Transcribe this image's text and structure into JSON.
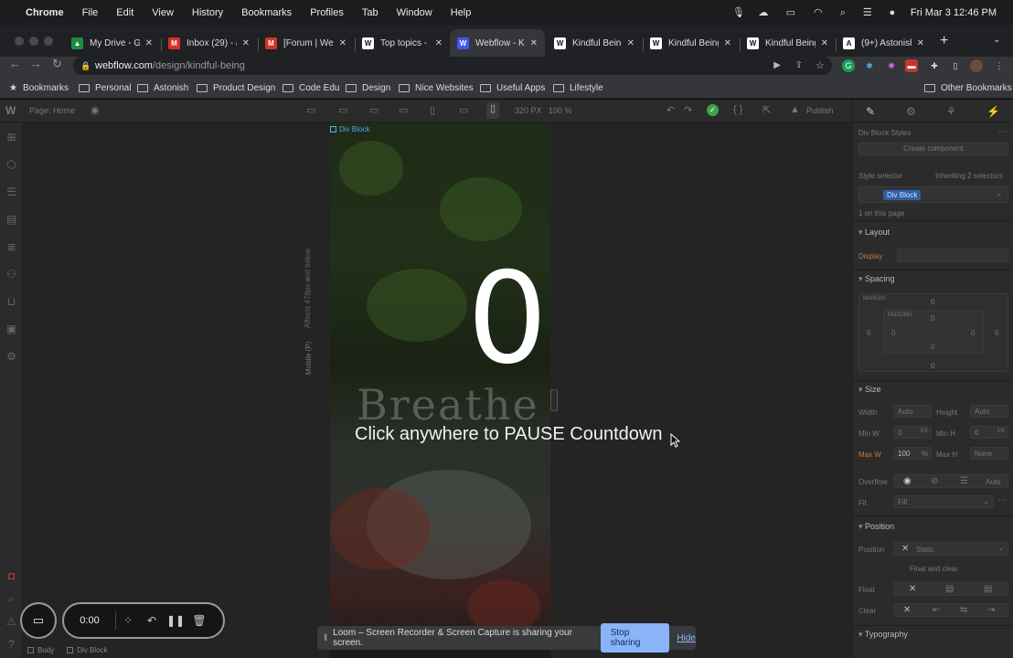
{
  "menubar": {
    "app": "Chrome",
    "items": [
      "File",
      "Edit",
      "View",
      "History",
      "Bookmarks",
      "Profiles",
      "Tab",
      "Window",
      "Help"
    ],
    "clock": "Fri Mar 3  12:46 PM"
  },
  "tabs": [
    {
      "title": "My Drive - Go",
      "favicon": "drive-icon",
      "color": "#f4b400"
    },
    {
      "title": "Inbox (29) - a",
      "favicon": "gmail-icon",
      "color": "#d93025"
    },
    {
      "title": "[Forum | Webf",
      "favicon": "gmail-icon",
      "color": "#d93025"
    },
    {
      "title": "Top topics - F",
      "favicon": "webflow-icon",
      "color": "#ffffff"
    },
    {
      "title": "Webflow - Kin",
      "favicon": "webflow-icon",
      "color": "#4353ff",
      "active": true
    },
    {
      "title": "Kindful Being",
      "favicon": "webflow-icon",
      "color": "#ffffff"
    },
    {
      "title": "Kindful Being",
      "favicon": "webflow-icon",
      "color": "#ffffff"
    },
    {
      "title": "Kindful Being",
      "favicon": "webflow-icon",
      "color": "#ffffff"
    },
    {
      "title": "(9+) Astonish",
      "favicon": "astonish-icon",
      "color": "#ffffff"
    }
  ],
  "address": {
    "host": "webflow.com",
    "path": "/design/kindful-being"
  },
  "bookmarks": {
    "label": "Bookmarks",
    "folders": [
      "Personal",
      "Astonish",
      "Product Design",
      "Code Edu",
      "Design",
      "Nice Websites",
      "Useful Apps",
      "Lifestyle"
    ],
    "other": "Other Bookmarks"
  },
  "designer": {
    "page_label": "Page: Home",
    "canvas_size": "320 PX",
    "zoom": "100 %",
    "publish": "Publish",
    "selected_tag": "Div Block",
    "breakpoint_note": "Affects 479px and below",
    "breakpoint_name": "Mobile (P)",
    "countdown": "0",
    "breathe": "Breathe",
    "instruction": "Click anywhere to PAUSE Countdown",
    "breadcrumbs": [
      "Body",
      "Div Block"
    ]
  },
  "style_panel": {
    "title": "Div Block Styles",
    "create_component": "Create component",
    "selector_label": "Style selector",
    "inheriting": "Inheriting 2 selectors",
    "chip": "Div Block",
    "on_page": "1 on this page",
    "sections": {
      "layout": "Layout",
      "spacing": "Spacing",
      "size": "Size",
      "position": "Position",
      "typography": "Typography"
    },
    "display_label": "Display",
    "margin_label": "MARGIN",
    "padding_label": "PADDING",
    "zero": "0",
    "width_label": "Width",
    "width_val": "Auto",
    "height_label": "Height",
    "height_val": "Auto",
    "minw_label": "Min W",
    "minw_val": "0",
    "minh_label": "Min H",
    "minh_val": "0",
    "maxw_label": "Max W",
    "maxw_val": "100",
    "maxw_unit": "%",
    "maxh_label": "Max H",
    "maxh_val": "None",
    "px_unit": "PX",
    "overflow_label": "Overflow",
    "overflow_auto": "Auto",
    "fit_label": "Fit",
    "fit_val": "Fill",
    "position_label": "Position",
    "position_val": "Static",
    "float_clear": "Float and clear",
    "float_label": "Float",
    "clear_label": "Clear"
  },
  "loom": {
    "time": "0:00"
  },
  "share_banner": {
    "text": "Loom – Screen Recorder & Screen Capture is sharing your screen.",
    "stop": "Stop sharing",
    "hide": "Hide"
  }
}
